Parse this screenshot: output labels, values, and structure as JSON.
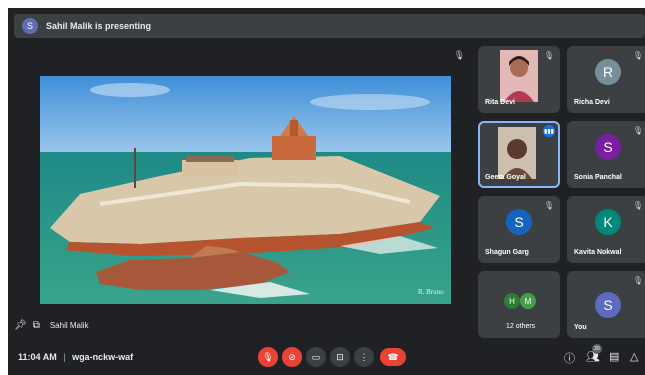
{
  "banner": {
    "avatar_letter": "S",
    "text": "Sahil Malik is presenting"
  },
  "main": {
    "presenter_name": "Sahil Malik",
    "watermark": "R. Bruno"
  },
  "participants": [
    {
      "name": "Rita Devi",
      "type": "photo"
    },
    {
      "name": "Richa Devi",
      "letter": "R",
      "color": "#78909c"
    },
    {
      "name": "Geeta Goyal",
      "type": "photo",
      "speaking": true
    },
    {
      "name": "Sonia Panchal",
      "letter": "S",
      "color": "#7b1fa2"
    },
    {
      "name": "Shagun Garg",
      "letter": "S",
      "color": "#1565c0"
    },
    {
      "name": "Kavita Nokwal",
      "letter": "K",
      "color": "#00897b"
    },
    {
      "name": "12 others",
      "letters": [
        "H",
        "M"
      ],
      "colors": [
        "#2e7d32",
        "#43a047"
      ]
    },
    {
      "name": "You",
      "letter": "S",
      "color": "#5c6bc0"
    }
  ],
  "bottom": {
    "time": "11:04 AM",
    "separator": "|",
    "meeting_code": "wga-nckw-waf",
    "people_count": "20"
  },
  "colors": {
    "background": "#202124",
    "tile": "#3c4043",
    "danger": "#ea4335",
    "speaking": "#8ab4f8"
  },
  "icons": [
    "mic-off-icon",
    "camera-off-icon",
    "captions-icon",
    "present-icon",
    "more-icon",
    "end-call-icon",
    "info-icon",
    "people-icon",
    "chat-icon",
    "activities-icon",
    "pin-icon"
  ]
}
